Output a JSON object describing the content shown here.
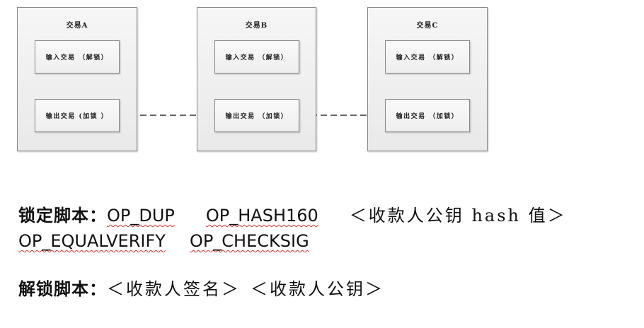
{
  "transactions": [
    {
      "title": "交易A",
      "input_label": "输入交易 （解锁）",
      "output_label": "输出交易 (加锁 ）"
    },
    {
      "title": "交易B",
      "input_label": "输入交易 （解锁）",
      "output_label": "输出交易 （加锁）"
    },
    {
      "title": "交易C",
      "input_label": "输入交易 （解锁）",
      "output_label": "输出交易 （加锁）"
    }
  ],
  "locking_script": {
    "label": "锁定脚本：",
    "op_dup": "OP_DUP",
    "op_hash160": "OP_HASH160",
    "pubkey_hash": "＜收款人公钥 hash 值＞",
    "op_equalverify": "OP_EQUALVERIFY",
    "op_checksig": "OP_CHECKSIG"
  },
  "unlocking_script": {
    "label": "解锁脚本：",
    "signature": "＜收款人签名＞",
    "pubkey": "＜收款人公钥＞"
  },
  "colors": {
    "panel_border": "#8a8a8a",
    "connector": "#333333",
    "spellcheck_underline": "#dd3333"
  }
}
